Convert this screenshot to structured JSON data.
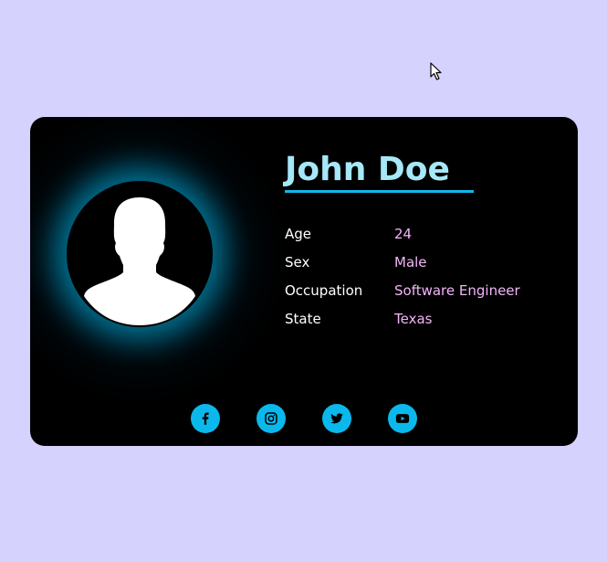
{
  "profile": {
    "name": "John Doe",
    "details": [
      {
        "label": "Age",
        "value": "24"
      },
      {
        "label": "Sex",
        "value": "Male"
      },
      {
        "label": "Occupation",
        "value": "Software Engineer"
      },
      {
        "label": "State",
        "value": "Texas"
      }
    ]
  },
  "social": [
    {
      "icon": "facebook-icon"
    },
    {
      "icon": "instagram-icon"
    },
    {
      "icon": "twitter-icon"
    },
    {
      "icon": "youtube-icon"
    }
  ],
  "colors": {
    "page_background": "#d6d2fe",
    "card_background": "#000000",
    "name": "#a6e8f7",
    "accent": "#12b6eb",
    "label": "#ffffff",
    "value": "#f3b5f8"
  }
}
